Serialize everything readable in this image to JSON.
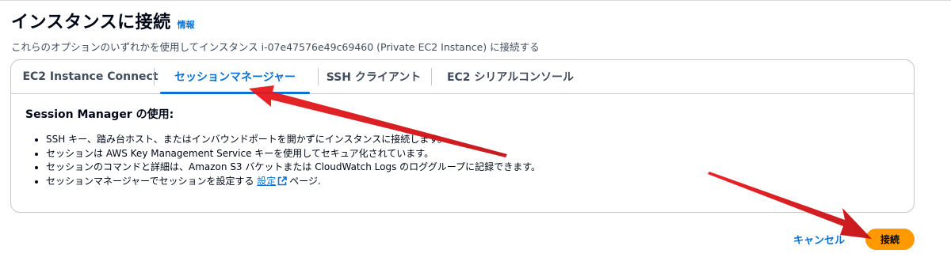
{
  "header": {
    "title": "インスタンスに接続",
    "info_link": "情報",
    "subtitle": "これらのオプションのいずれかを使用してインスタンス i-07e47576e49c69460 (Private EC2 Instance) に接続する"
  },
  "tabs": [
    {
      "label": "EC2 Instance Connect",
      "active": false
    },
    {
      "label": "セッションマネージャー",
      "active": true
    },
    {
      "label": "SSH クライアント",
      "active": false
    },
    {
      "label": "EC2 シリアルコンソール",
      "active": false
    }
  ],
  "content": {
    "heading": "Session Manager の使用:",
    "bullets": [
      "SSH キー、踏み台ホスト、またはインバウンドポートを開かずにインスタンスに接続します。",
      "セッションは AWS Key Management Service キーを使用してセキュア化されています。",
      "セッションのコマンドと詳細は、Amazon S3 バケットまたは CloudWatch Logs のロググループに記録できます。"
    ],
    "last_bullet": {
      "prefix": "セッションマネージャーでセッションを設定する",
      "link": "設定",
      "suffix": "ページ."
    }
  },
  "footer": {
    "cancel_label": "キャンセル",
    "connect_label": "接続"
  },
  "colors": {
    "accent": "#0972d3",
    "primary_button": "#ff9900",
    "annotation_arrow": "#e8191d"
  },
  "icons": {
    "external_link": "external-link-icon",
    "annotation_arrows": "red-arrow-icon"
  }
}
